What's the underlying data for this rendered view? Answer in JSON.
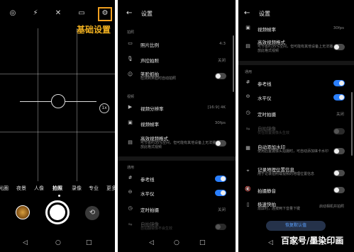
{
  "camera": {
    "top_icons": [
      "aperture-icon",
      "flash-off-icon",
      "ai-off-icon",
      "aspect-ratio-icon",
      "gear-icon"
    ],
    "callout": "基础设置",
    "zoom": "1x",
    "modes": [
      "光圈",
      "夜景",
      "人像",
      "拍照",
      "录像",
      "专业",
      "更多"
    ],
    "active_mode": "拍照"
  },
  "settings_title": "设置",
  "panel1": {
    "section_photo": "拍照",
    "aspect_ratio": {
      "label": "照片比例",
      "value": "4:3"
    },
    "voice_capture": {
      "label": "声控拍照",
      "value": "关闭"
    },
    "smile_capture": {
      "label": "笑脸抓拍",
      "sub": "检测到笑脸时自动拍照",
      "on": false
    },
    "section_video": "视频",
    "video_resolution": {
      "label": "视频分辨率",
      "value": "[16:9] 4K"
    },
    "video_fps": {
      "label": "视频帧率",
      "value": "30fps"
    },
    "efficient_format": {
      "label": "高效视频格式",
      "sub": "可节省约35%空间，但可能有其他设备上无法播放此格式视频",
      "on": false
    },
    "section_general": "通用",
    "grid": {
      "label": "参考线",
      "on": true
    },
    "level": {
      "label": "水平仪",
      "on": true
    },
    "timer": {
      "label": "定时拍摄",
      "value": "关闭"
    },
    "mirror": {
      "label": "自拍镜像",
      "sub": "自拍翻镜像不会生效"
    }
  },
  "panel2": {
    "video_fps": {
      "label": "视频帧率",
      "value": "30fps"
    },
    "efficient_format": {
      "label": "高效视频格式",
      "sub": "可节省约35%空间，但可能有其他设备上无法播放此格式视频",
      "on": false
    },
    "section_general": "通用",
    "grid": {
      "label": "参考线",
      "on": true
    },
    "level": {
      "label": "水平仪",
      "on": true
    },
    "timer": {
      "label": "定时拍摄",
      "value": "关闭"
    },
    "mirror": {
      "label": "自拍镜像",
      "sub": "仅在前置摄像头生效"
    },
    "watermark_toggle": {
      "label": "自动添加水印",
      "sub": "使用后置摄像头拍摄时，可自动添加徕卡水印",
      "on": false
    },
    "location": {
      "label": "记录地理位置信息",
      "sub": "用于记录拍照或视频的地理位置信息",
      "on": false
    },
    "mute": {
      "label": "拍摄静音",
      "on": false
    },
    "quick_snap": {
      "label": "极速快拍",
      "sub": "熄屏时，连按两下音量下键",
      "value": "启动相机并拍照"
    },
    "reset_button": "恢复默认值"
  },
  "watermark_text": "百家号/墨染印画"
}
